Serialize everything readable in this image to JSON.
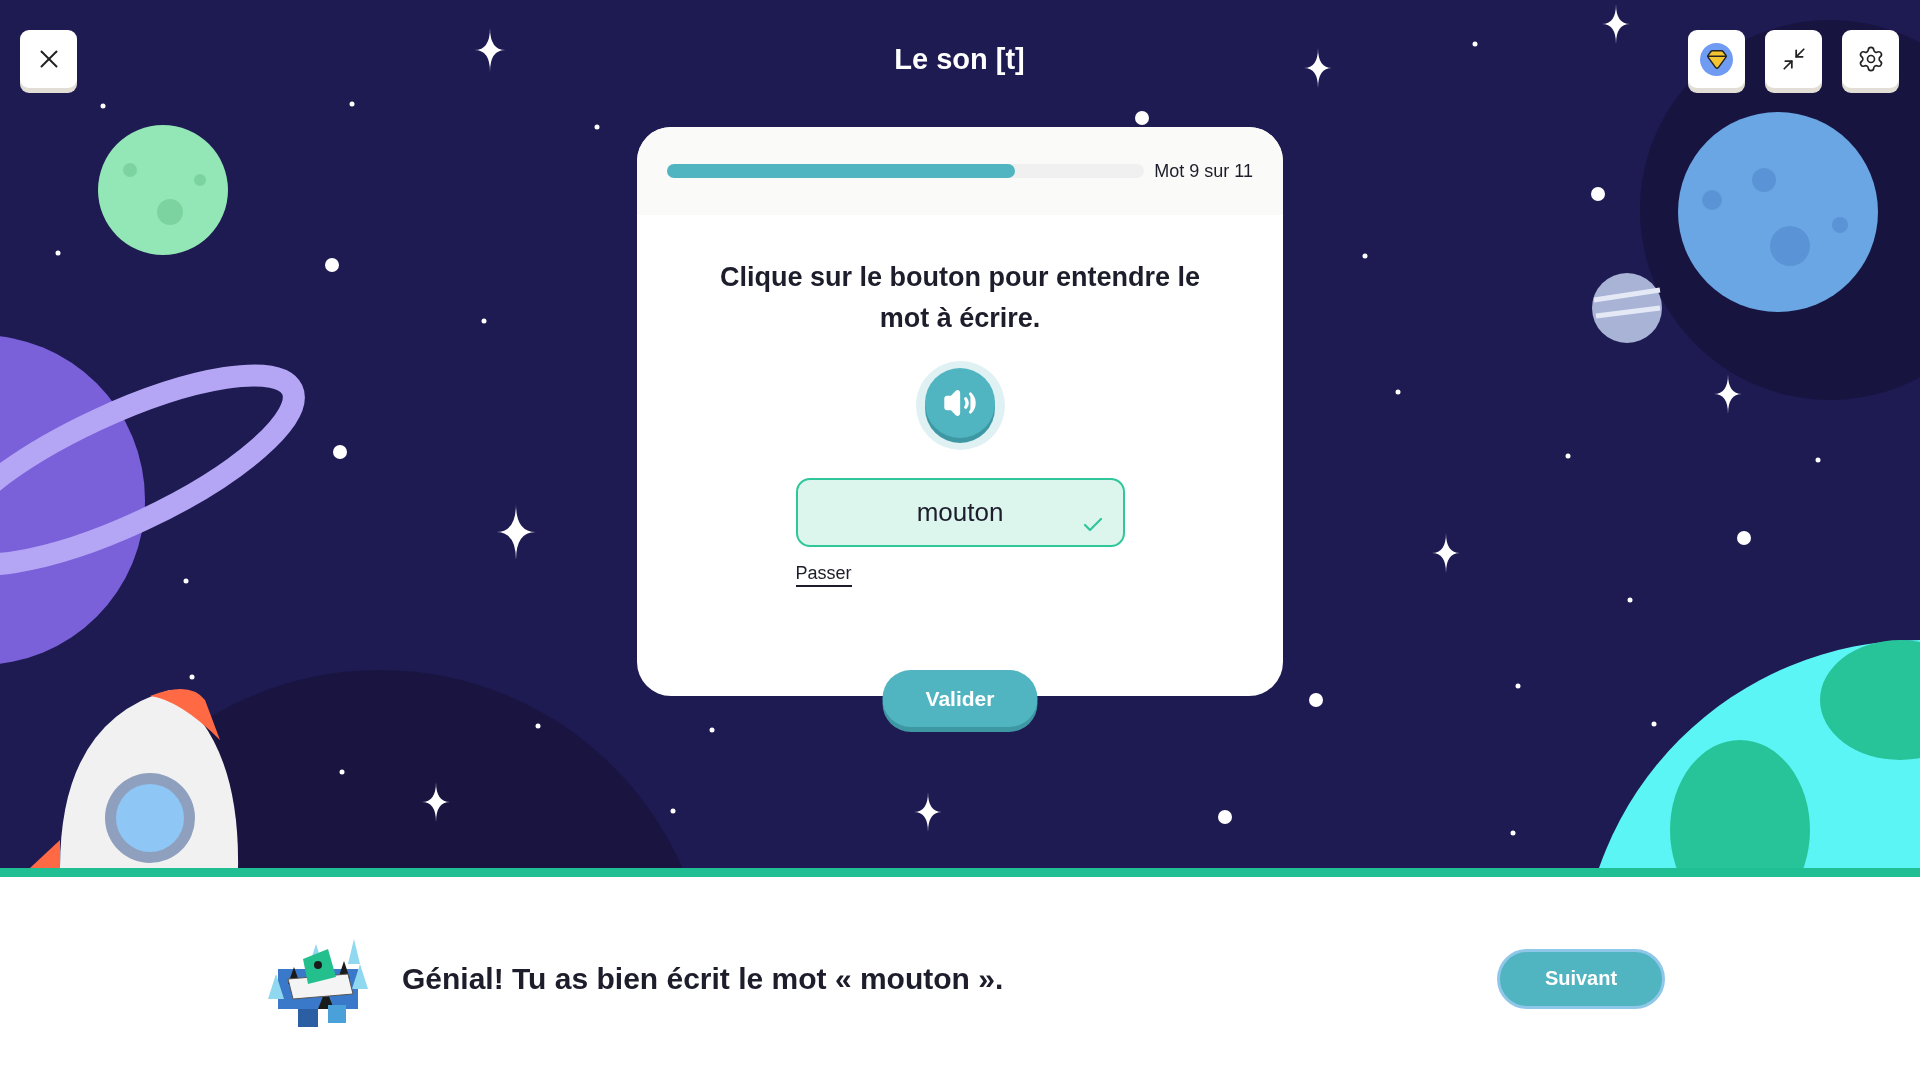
{
  "title": "Le son [t]",
  "progress": {
    "level": 0.73,
    "label": "Mot 9 sur 11"
  },
  "instruction": "Clique sur le bouton pour entendre le mot à écrire.",
  "answer": {
    "value": "mouton",
    "correct": true
  },
  "skip_link": "Passer",
  "validate_button": "Valider",
  "feedback": {
    "message": "Génial! Tu as bien écrit le mot « mouton ».",
    "correct": true
  },
  "next_button": "Suivant"
}
